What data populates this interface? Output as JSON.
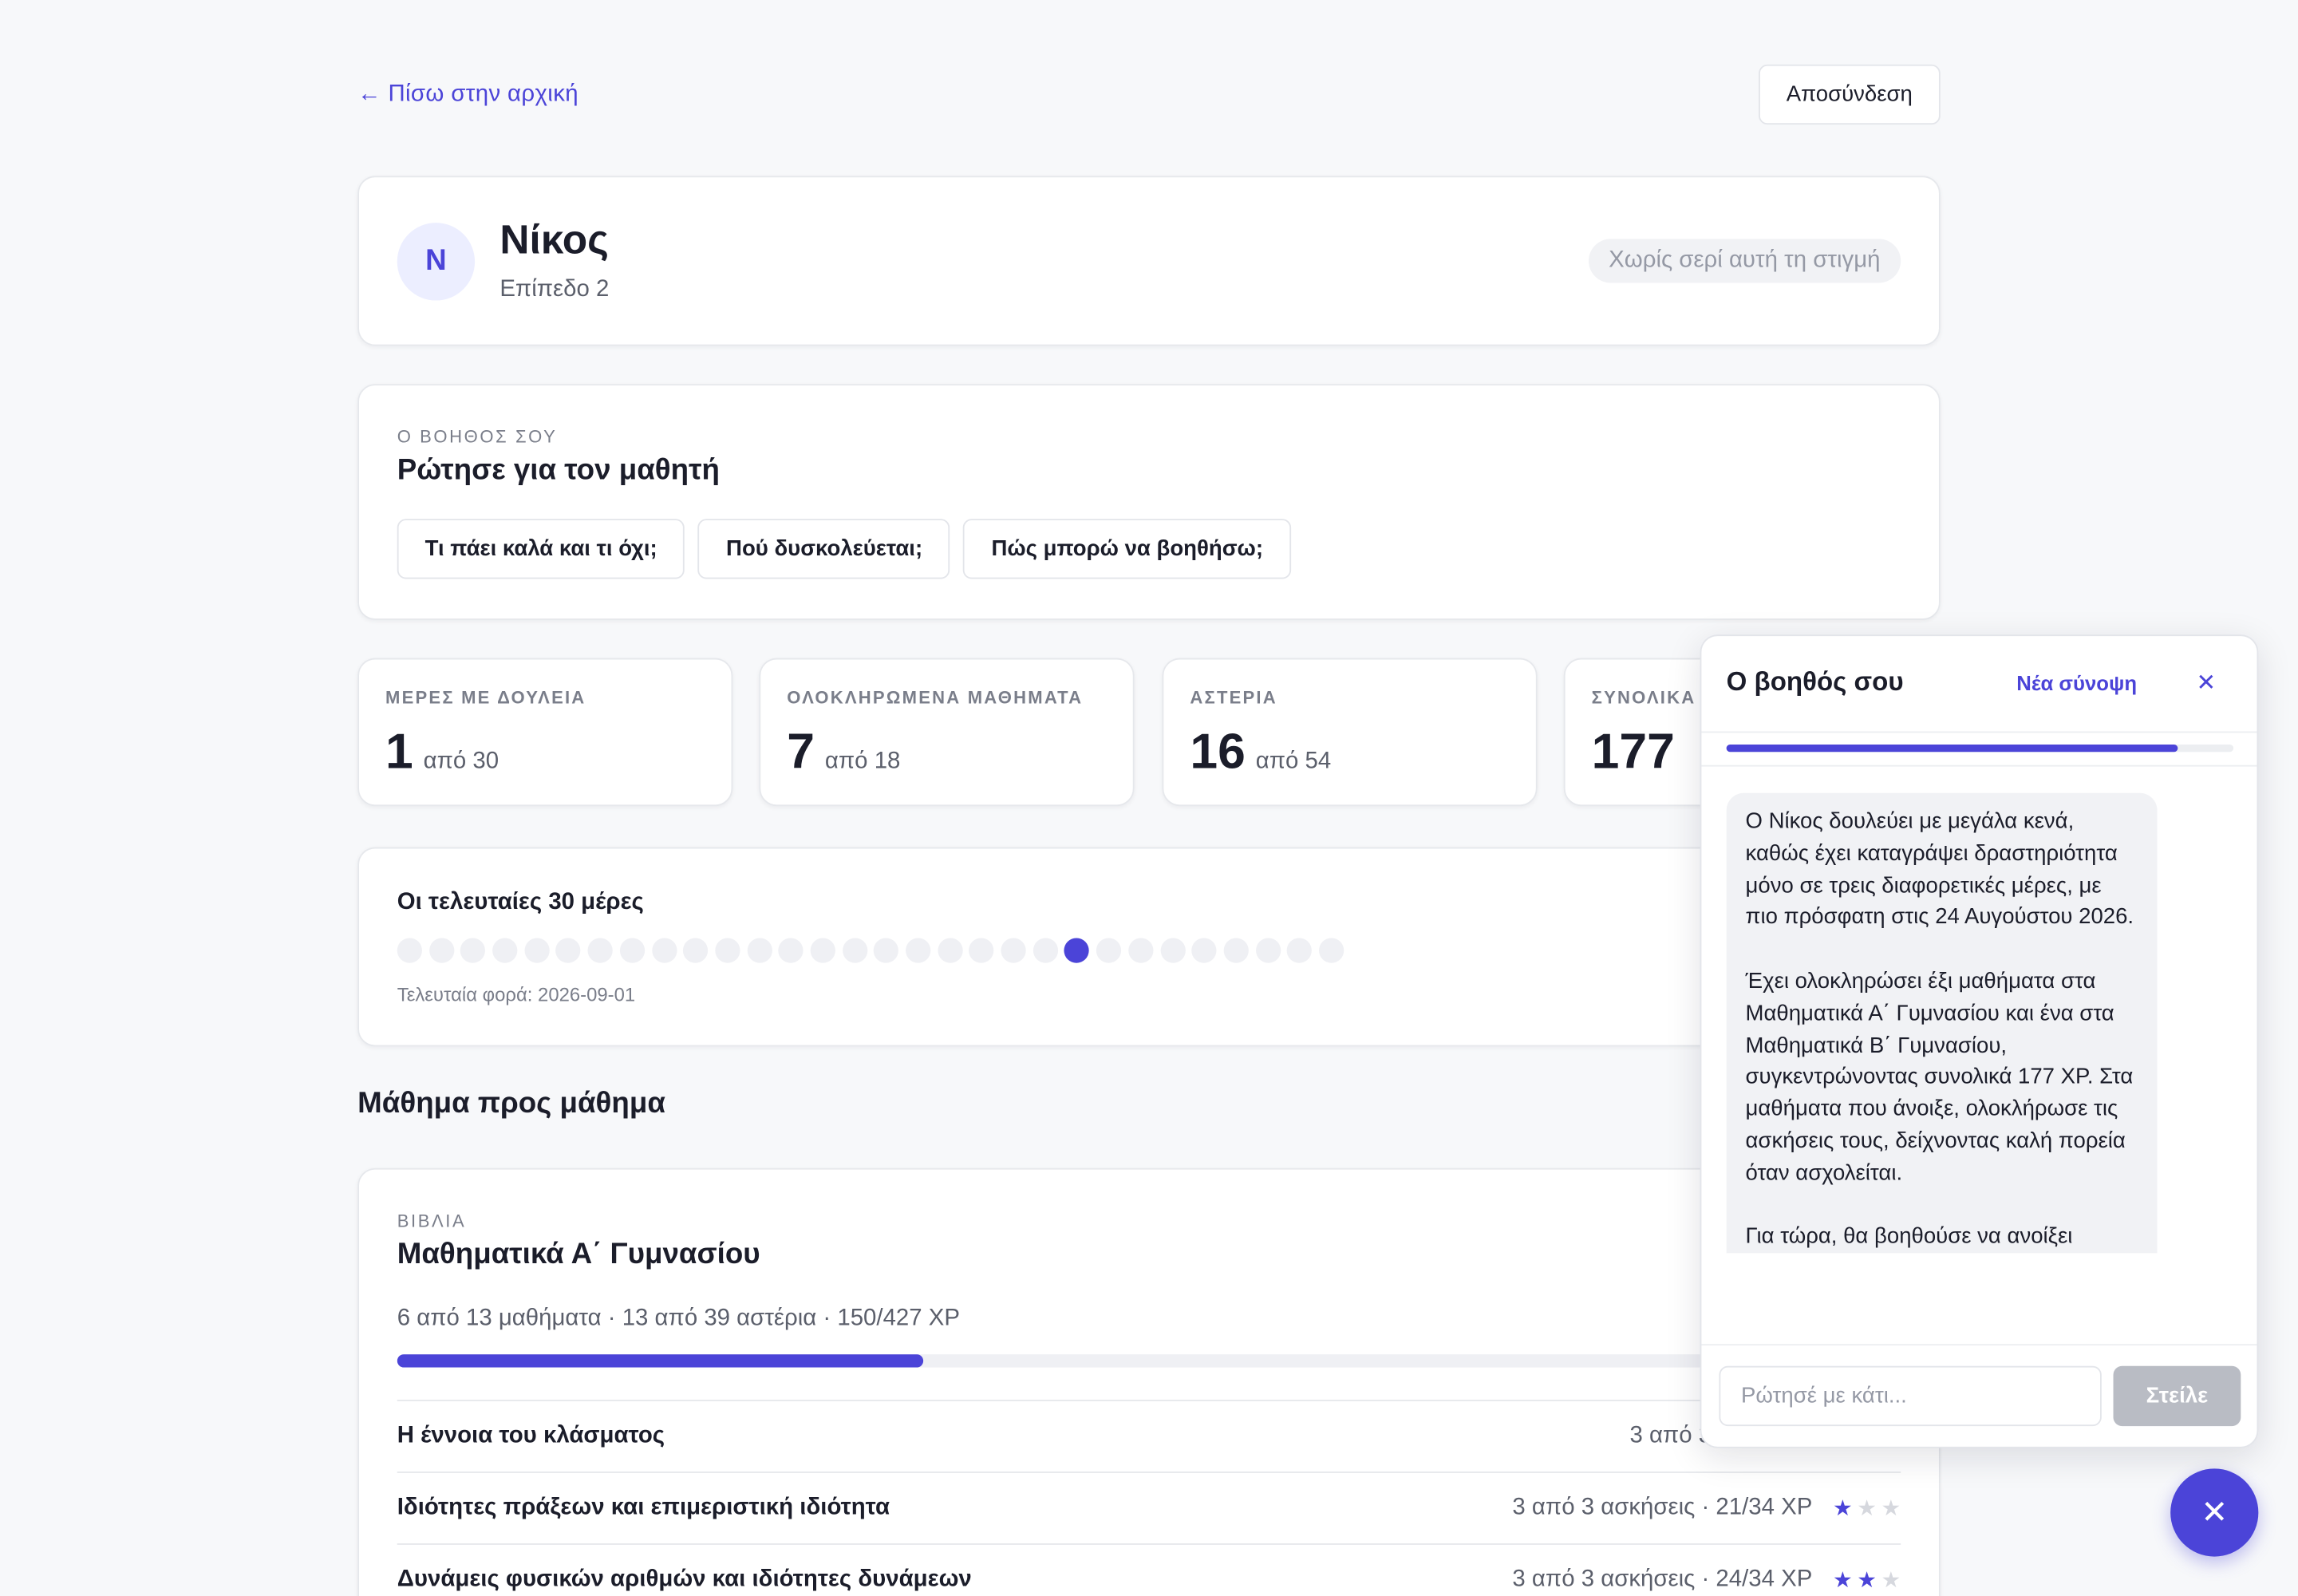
{
  "nav": {
    "back_label": "← Πίσω στην αρχική",
    "logout_label": "Αποσύνδεση"
  },
  "profile": {
    "initial": "N",
    "name": "Νίκος",
    "level": "Επίπεδο 2",
    "streak": "Χωρίς σερί αυτή τη στιγμή"
  },
  "assistant": {
    "eyebrow": "Ο ΒΟΗΘΟΣ ΣΟΥ",
    "title": "Ρώτησε για τον μαθητή",
    "chips": [
      "Τι πάει καλά και τι όχι;",
      "Πού δυσκολεύεται;",
      "Πώς μπορώ να βοηθήσω;"
    ]
  },
  "stats": [
    {
      "label": "ΜΕΡΕΣ ΜΕ ΔΟΥΛΕΙΑ",
      "value": "1",
      "sub": "από 30"
    },
    {
      "label": "ΟΛΟΚΛΗΡΩΜΕΝΑ ΜΑΘΗΜΑΤΑ",
      "value": "7",
      "sub": "από 18"
    },
    {
      "label": "ΑΣΤΕΡΙΑ",
      "value": "16",
      "sub": "από 54"
    },
    {
      "label": "ΣΥΝΟΛΙΚΑ",
      "value": "177",
      "sub": ""
    }
  ],
  "activity": {
    "title": "Οι τελευταίες 30 μέρες",
    "count": "1",
    "total_days": 30,
    "active_day_index": 21,
    "last_seen": "Τελευταία φορά: 2026-09-01"
  },
  "section_title": "Μάθημα προς μάθημα",
  "book": {
    "eyebrow": "ΒΙΒΛΙΑ",
    "title": "Μαθηματικά Α΄ Γυμνασίου",
    "summary": "6 από 13 μαθήματα · 13 από 39 αστέρια · 150/427 XP",
    "progress": 0.35,
    "lessons": [
      {
        "name": "Η έννοια του κλάσματος",
        "meta": "3 από 3 ασκήσεις",
        "stars": 0
      },
      {
        "name": "Ιδιότητες πράξεων και επιμεριστική ιδιότητα",
        "meta": "3 από 3 ασκήσεις · 21/34 XP",
        "stars": 1
      },
      {
        "name": "Δυνάμεις φυσικών αριθμών και ιδιότητες δυνάμεων",
        "meta": "3 από 3 ασκήσεις · 24/34 XP",
        "stars": 2
      }
    ]
  },
  "chat": {
    "title": "Ο βοηθός σου",
    "new_summary": "Νέα σύνοψη",
    "progress": 0.89,
    "message": "Ο Νίκος δουλεύει με μεγάλα κενά, καθώς έχει καταγράψει δραστηριότητα μόνο σε τρεις διαφορετικές μέρες, με πιο πρόσφατη στις 24 Αυγούστου 2026.\n\nΈχει ολοκληρώσει έξι μαθήματα στα Μαθηματικά Α΄ Γυμνασίου και ένα στα Μαθηματικά Β΄ Γυμνασίου, συγκεντρώνοντας συνολικά 177 XP. Στα μαθήματα που άνοιξε, ολοκλήρωσε τις ασκήσεις τους, δείχνοντας καλή πορεία όταν ασχολείται.\n\nΓια τώρα, θα βοηθούσε να ανοίξει",
    "input_placeholder": "Ρώτησέ με κάτι...",
    "send_label": "Στείλε"
  },
  "colors": {
    "accent": "#4b44d8",
    "background": "#f7f8fa",
    "muted": "#7a7e8a"
  },
  "icons": {
    "close": "close-icon",
    "fab": "close-icon",
    "star": "star-icon"
  }
}
